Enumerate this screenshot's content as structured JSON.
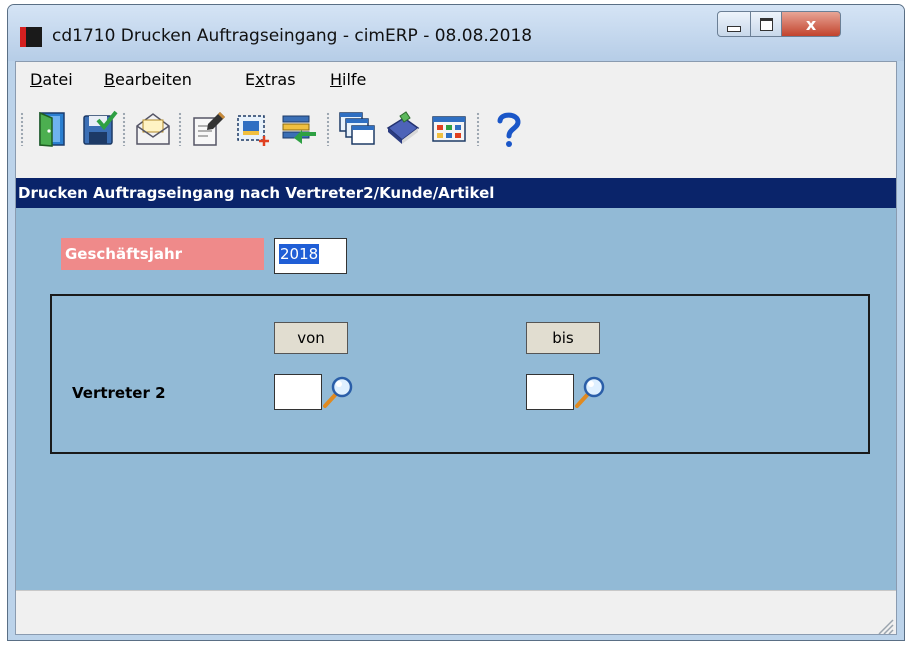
{
  "window": {
    "title": "cd1710 Drucken Auftragseingang - cimERP - 08.08.2018",
    "close_glyph": "x"
  },
  "menu": [
    {
      "accel": "D",
      "rest": "atei"
    },
    {
      "accel": "B",
      "rest": "earbeiten"
    },
    {
      "pre": "E",
      "accel": "x",
      "rest": "tras"
    },
    {
      "accel": "H",
      "rest": "ilfe"
    }
  ],
  "toolbar": {
    "icons": [
      "exit-door-icon",
      "save-check-icon",
      "mail-envelope-icon",
      "edit-document-icon",
      "new-record-icon",
      "transfer-icon",
      "windows-icon",
      "book-icon",
      "grid-view-icon",
      "help-icon"
    ]
  },
  "form": {
    "header": "Drucken Auftragseingang nach Vertreter2/Kunde/Artikel",
    "geschaeftsjahr_label": "Geschäftsjahr",
    "geschaeftsjahr_value": "2018",
    "von_label": "von",
    "bis_label": "bis",
    "vertreter_label": "Vertreter 2",
    "vertreter_von_value": "",
    "vertreter_bis_value": ""
  },
  "colors": {
    "header_bg": "#0a246a",
    "panel_bg": "#92bad6",
    "label_bg": "#ef8a8a",
    "selection": "#1f5ed6"
  }
}
